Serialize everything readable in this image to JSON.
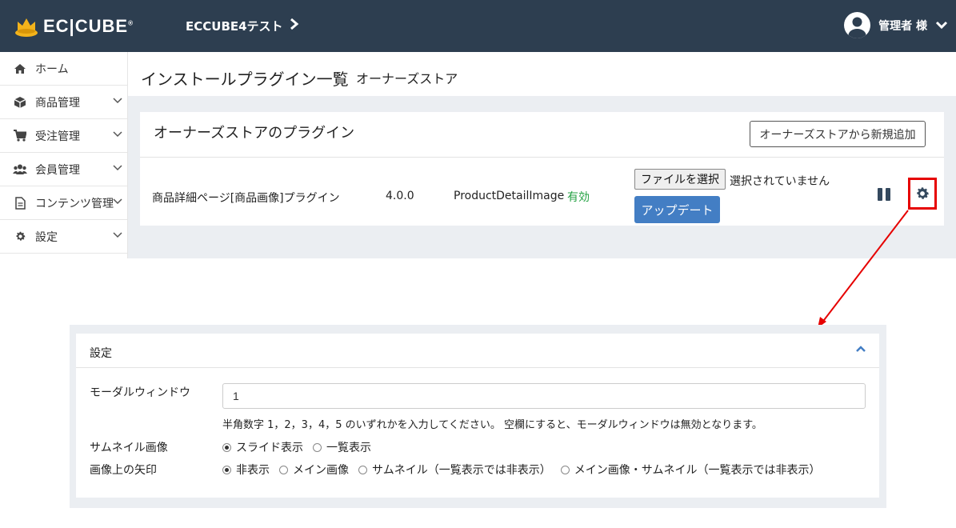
{
  "header": {
    "logo_text": "EC|CUBE",
    "logo_mark": "®",
    "shop_name": "ECCUBE4テスト",
    "user_label": "管理者 様"
  },
  "sidebar": {
    "items": [
      {
        "label": "ホーム",
        "icon": "home-icon"
      },
      {
        "label": "商品管理",
        "icon": "cube-icon"
      },
      {
        "label": "受注管理",
        "icon": "cart-icon"
      },
      {
        "label": "会員管理",
        "icon": "users-icon"
      },
      {
        "label": "コンテンツ管理",
        "icon": "file-icon"
      },
      {
        "label": "設定",
        "icon": "gear-icon"
      }
    ]
  },
  "page": {
    "title": "インストールプラグイン一覧",
    "subtitle": "オーナーズストア"
  },
  "plugins_card": {
    "title": "オーナーズストアのプラグイン",
    "add_button": "オーナーズストアから新規追加",
    "row": {
      "name": "商品詳細ページ[商品画像]プラグイン",
      "version": "4.0.0",
      "code": "ProductDetailImage",
      "status": "有効",
      "file_button": "ファイルを選択",
      "file_status": "選択されていません",
      "update_button": "アップデート"
    }
  },
  "settings_panel": {
    "title": "設定",
    "modal_label": "モーダルウィンドウ",
    "modal_value": "1",
    "modal_help": "半角数字 1，2，3，4，5 のいずれかを入力してください。 空欄にすると、モーダルウィンドウは無効となります。",
    "thumb_label": "サムネイル画像",
    "thumb_options": [
      "スライド表示",
      "一覧表示"
    ],
    "thumb_selected": 0,
    "arrow_label": "画像上の矢印",
    "arrow_options": [
      "非表示",
      "メイン画像",
      "サムネイル（一覧表示では非表示）",
      "メイン画像・サムネイル（一覧表示では非表示）"
    ],
    "arrow_selected": 0
  },
  "colors": {
    "header_bg": "#2d3e50",
    "primary": "#437ec4",
    "status_green": "#25a244",
    "highlight_red": "#e60000"
  }
}
